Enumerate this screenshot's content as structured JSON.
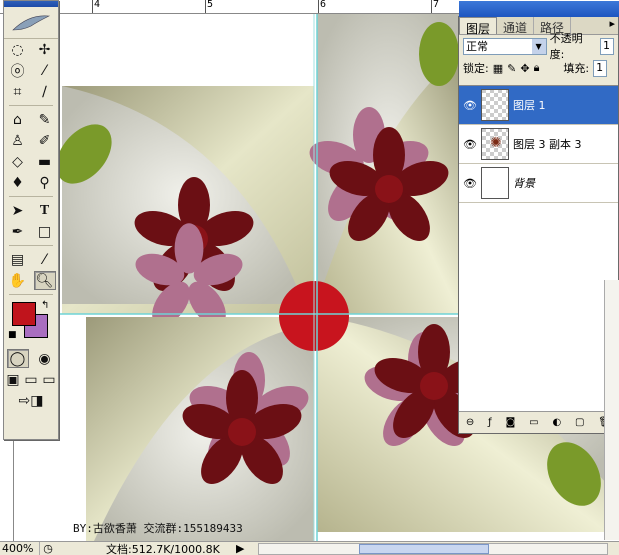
{
  "rulers": {
    "top_labels": [
      "4",
      "5",
      "6",
      "7"
    ]
  },
  "canvas": {
    "credit": "BY:古欲香萧 交流群:155189433"
  },
  "toolbox": {
    "tools": [
      [
        "marquee-icon",
        "move-icon"
      ],
      [
        "lasso-icon",
        "magic-wand-icon"
      ],
      [
        "crop-icon",
        "slice-icon"
      ],
      [
        "healing-icon",
        "brush-icon"
      ],
      [
        "stamp-icon",
        "history-brush-icon"
      ],
      [
        "eraser-icon",
        "gradient-icon"
      ],
      [
        "blur-icon",
        "dodge-icon"
      ],
      [
        "path-select-icon",
        "type-icon"
      ],
      [
        "pen-icon",
        "shape-icon"
      ],
      [
        "notes-icon",
        "eyedropper-icon"
      ],
      [
        "hand-icon",
        "zoom-icon"
      ]
    ],
    "foreground_color": "#c0141c",
    "background_color": "#a96ec0"
  },
  "layers": {
    "tabs": [
      "图层",
      "通道",
      "路径"
    ],
    "blend_mode": "正常",
    "opacity_label": "不透明度:",
    "opacity_value": "1",
    "lock_label": "锁定:",
    "fill_label": "填充:",
    "fill_value": "1",
    "items": [
      {
        "name": "图层 1",
        "selected": true
      },
      {
        "name": "图层 3 副本 3",
        "selected": false
      },
      {
        "name": "背景",
        "selected": false
      }
    ]
  },
  "status": {
    "zoom": "400%",
    "doc_info": "文档:512.7K/1000.8K"
  }
}
